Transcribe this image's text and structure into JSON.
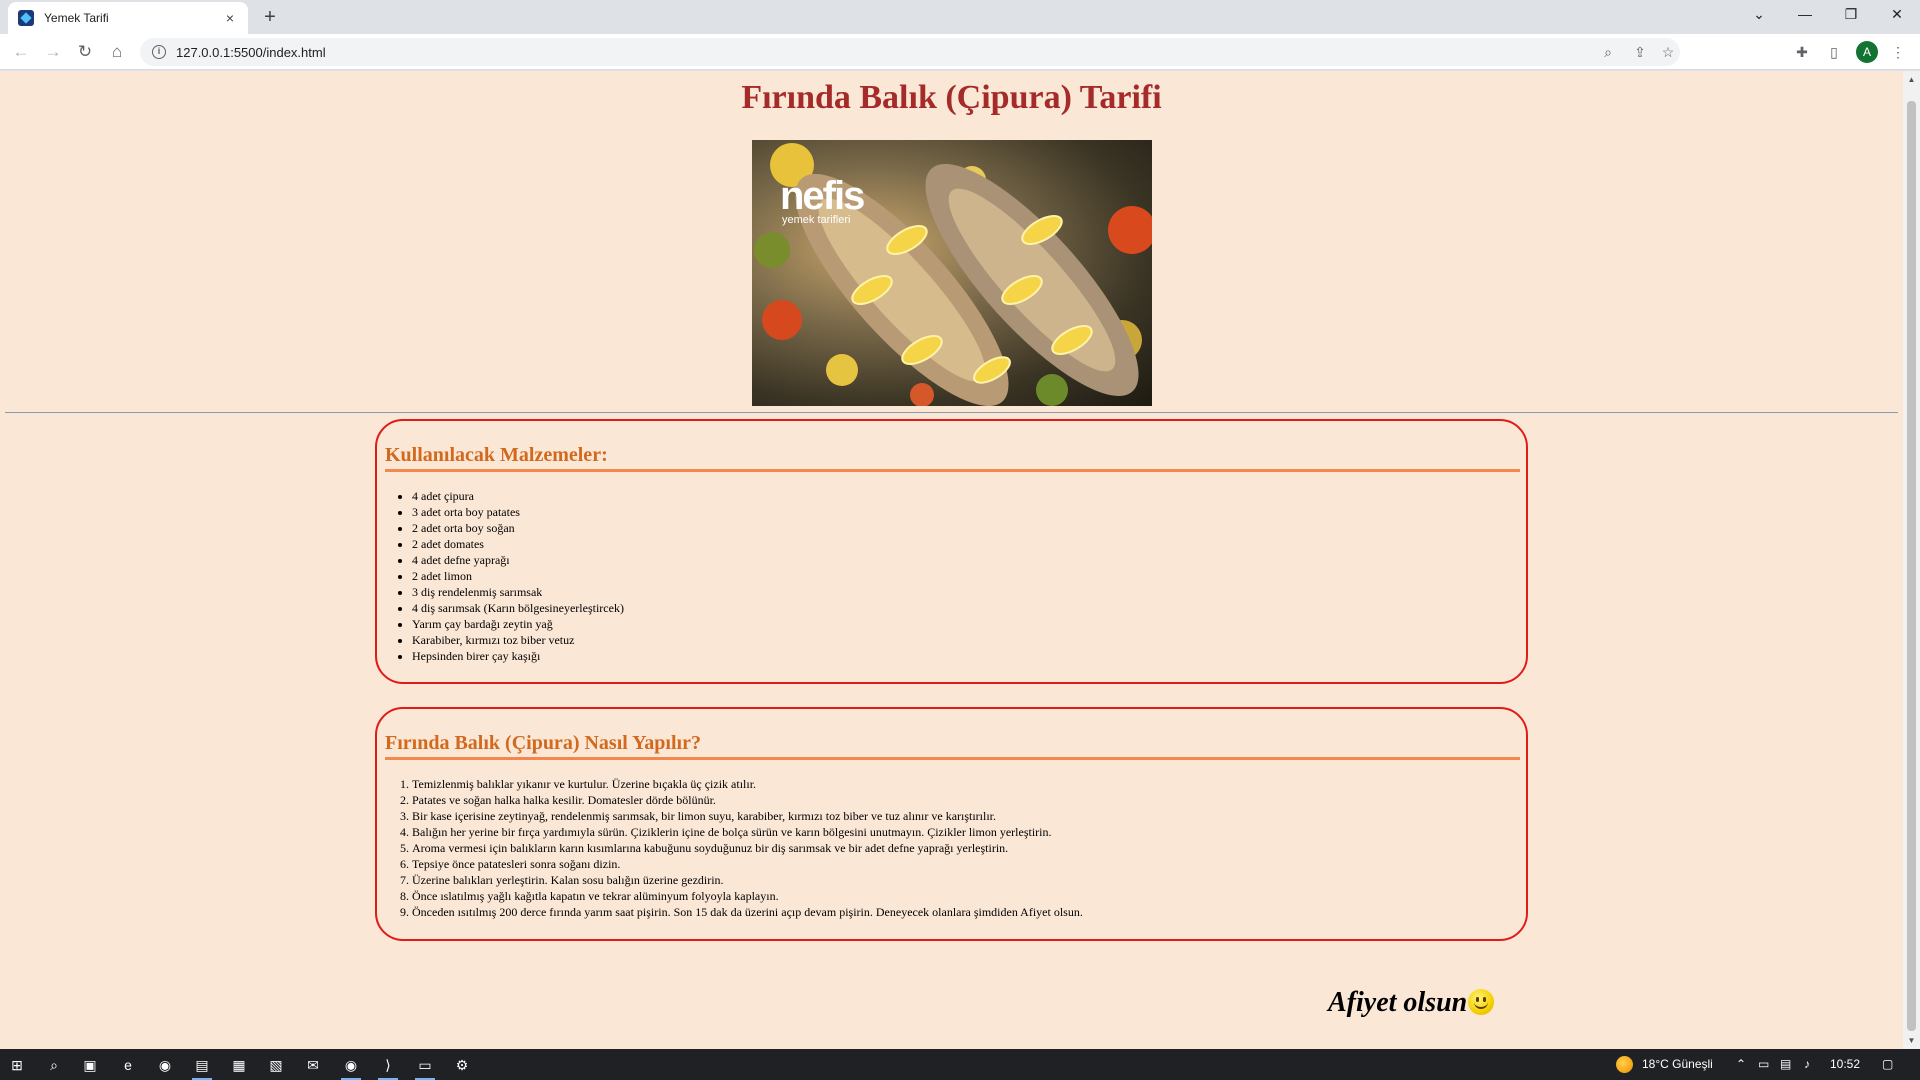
{
  "browser": {
    "tab_title": "Yemek Tarifi",
    "tab_close": "×",
    "new_tab": "+",
    "url": "127.0.0.1:5500/index.html",
    "window_controls": {
      "dropdown": "⌄",
      "minimize": "—",
      "restore": "❐",
      "close": "✕"
    },
    "profile_initial": "A"
  },
  "page": {
    "title": "Fırında Balık (Çipura) Tarifi",
    "image_logo": "nefis",
    "image_logo_sub": "yemek tarifleri",
    "ingredients": {
      "heading": "Kullanılacak Malzemeler:",
      "items": [
        "4 adet çipura",
        "3 adet orta boy patates",
        "2 adet orta boy soğan",
        "2 adet domates",
        "4 adet defne yaprağı",
        "2 adet limon",
        "3 diş rendelenmiş sarımsak",
        "4 diş sarımsak (Karın bölgesineyerleştircek)",
        "Yarım çay bardağı zeytin yağ",
        "Karabiber, kırmızı toz biber vetuz",
        "Hepsinden birer çay kaşığı"
      ]
    },
    "steps": {
      "heading": "Fırında Balık (Çipura) Nasıl Yapılır?",
      "items": [
        "Temizlenmiş balıklar yıkanır ve kurtulur. Üzerine bıçakla üç çizik atılır.",
        "Patates ve soğan halka halka kesilir. Domatesler dörde bölünür.",
        "Bir kase içerisine zeytinyağ, rendelenmiş sarımsak, bir limon suyu, karabiber, kırmızı toz biber ve tuz alınır ve karıştırılır.",
        "Balığın her yerine bir fırça yardımıyla sürün. Çiziklerin içine de bolça sürün ve karın bölgesini unutmayın. Çizikler limon yerleştirin.",
        "Aroma vermesi için balıkların karın kısımlarına kabuğunu soyduğunuz bir diş sarımsak ve bir adet defne yaprağı yerleştirin.",
        "Tepsiye önce patatesleri sonra soğanı dizin.",
        "Üzerine balıkları yerleştirin. Kalan sosu balığın üzerine gezdirin.",
        "Önce ıslatılmış yağlı kağıtla kapatın ve tekrar alüminyum folyoyla kaplayın.",
        "Önceden ısıtılmış 200 derce fırında yarım saat pişirin. Son 15 dak da üzerini açıp devam pişirin. Deneyecek olanlara şimdiden Afiyet olsun."
      ]
    },
    "closing": "Afiyet olsun"
  },
  "taskbar": {
    "weather": "18°C  Güneşli",
    "time": "10:52"
  },
  "colors": {
    "page_bg": "#fae7d6",
    "title": "#a52a2a",
    "heading": "#d2691e",
    "card_border": "#e01b1b",
    "heading_rule": "#f4874b"
  }
}
